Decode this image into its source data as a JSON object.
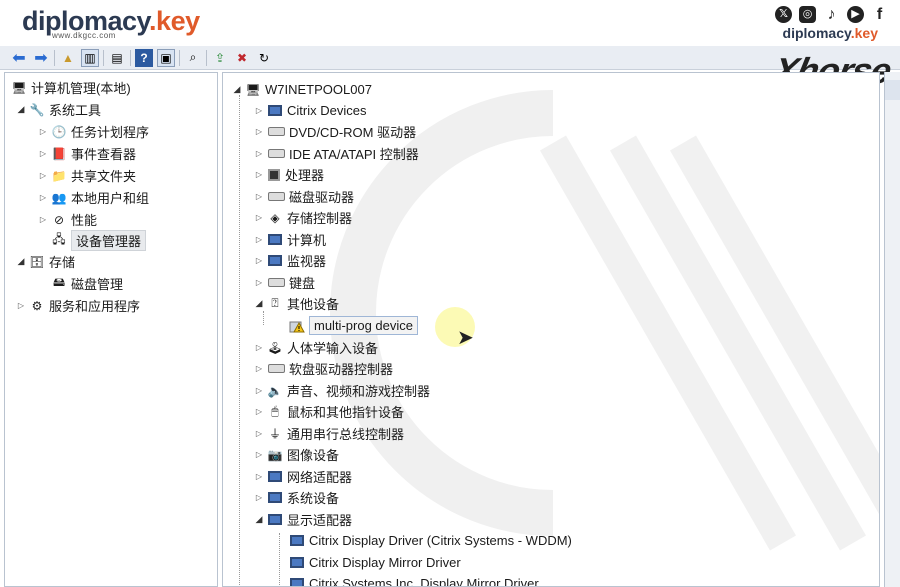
{
  "brand": {
    "name_main": "diplomacy",
    "name_dot": ".key",
    "sub": "www.dkgcc.com",
    "right_main": "diplomacy",
    "right_dot": ".key"
  },
  "socials": [
    "x-icon",
    "instagram-icon",
    "tiktok-icon",
    "youtube-icon",
    "facebook-icon"
  ],
  "xhorse_logo": "Xhorse",
  "left_tree": [
    {
      "label": "计算机管理(本地)",
      "icon": "computer-management-icon"
    },
    {
      "label": "系统工具",
      "icon": "tools-icon"
    },
    {
      "label": "任务计划程序",
      "icon": "clock-icon"
    },
    {
      "label": "事件查看器",
      "icon": "event-viewer-icon"
    },
    {
      "label": "共享文件夹",
      "icon": "shared-folder-icon"
    },
    {
      "label": "本地用户和组",
      "icon": "users-icon"
    },
    {
      "label": "性能",
      "icon": "performance-icon"
    },
    {
      "label": "设备管理器",
      "icon": "device-manager-icon"
    },
    {
      "label": "存储",
      "icon": "storage-icon"
    },
    {
      "label": "磁盘管理",
      "icon": "disk-management-icon"
    },
    {
      "label": "服务和应用程序",
      "icon": "services-icon"
    }
  ],
  "device_tree": {
    "root": "W7INETPOOL007",
    "items": [
      "Citrix Devices",
      "DVD/CD-ROM 驱动器",
      "IDE ATA/ATAPI 控制器",
      "处理器",
      "磁盘驱动器",
      "存储控制器",
      "计算机",
      "监视器",
      "键盘",
      "其他设备",
      "multi-prog device",
      "人体学输入设备",
      "软盘驱动器控制器",
      "声音、视频和游戏控制器",
      "鼠标和其他指针设备",
      "通用串行总线控制器",
      "图像设备",
      "网络适配器",
      "系统设备",
      "显示适配器",
      "Citrix Display Driver (Citrix Systems - WDDM)",
      "Citrix Display Mirror Driver",
      "Citrix Systems Inc. Display Mirror Driver"
    ]
  }
}
